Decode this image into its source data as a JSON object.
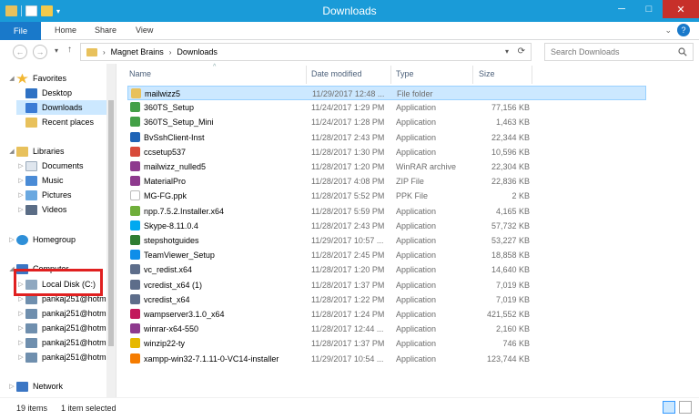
{
  "window": {
    "title": "Downloads",
    "minimize": "─",
    "maximize": "□",
    "close": "✕"
  },
  "ribbon": {
    "tabs": [
      "File",
      "Home",
      "Share",
      "View"
    ],
    "expand": "⌄",
    "help": "?"
  },
  "address": {
    "back": "←",
    "forward": "→",
    "recent": "▾",
    "up": "↑",
    "chevron": "›",
    "crumbs": [
      "Magnet Brains",
      "Downloads"
    ],
    "search_placeholder": "Search Downloads"
  },
  "nav": {
    "favorites": "Favorites",
    "desktop": "Desktop",
    "downloads": "Downloads",
    "recent_places": "Recent places",
    "libraries": "Libraries",
    "documents": "Documents",
    "music": "Music",
    "pictures": "Pictures",
    "videos": "Videos",
    "homegroup": "Homegroup",
    "computer": "Computer",
    "local_disk": "Local Disk (C:)",
    "network_drives": [
      "pankaj251@hotm",
      "pankaj251@hotm",
      "pankaj251@hotm",
      "pankaj251@hotm",
      "pankaj251@hotm"
    ],
    "network": "Network"
  },
  "columns": {
    "name": "Name",
    "date": "Date modified",
    "type": "Type",
    "size": "Size",
    "sort_indicator": "^"
  },
  "files": [
    {
      "name": "mailwizz5",
      "date": "11/29/2017 12:48 ...",
      "type": "File folder",
      "size": "",
      "icon": "folder-icon",
      "color": "#e8c15c"
    },
    {
      "name": "360TS_Setup",
      "date": "11/24/2017 1:29 PM",
      "type": "Application",
      "size": "77,156 KB",
      "icon": "app-360-icon",
      "color": "#43a047"
    },
    {
      "name": "360TS_Setup_Mini",
      "date": "11/24/2017 1:28 PM",
      "type": "Application",
      "size": "1,463 KB",
      "icon": "app-360-icon",
      "color": "#43a047"
    },
    {
      "name": "BvSshClient-Inst",
      "date": "11/28/2017 2:43 PM",
      "type": "Application",
      "size": "22,344 KB",
      "icon": "app-bvssh-icon",
      "color": "#1e63b6"
    },
    {
      "name": "ccsetup537",
      "date": "11/28/2017 1:30 PM",
      "type": "Application",
      "size": "10,596 KB",
      "icon": "app-ccleaner-icon",
      "color": "#d84b3b"
    },
    {
      "name": "mailwizz_nulled5",
      "date": "11/28/2017 1:20 PM",
      "type": "WinRAR archive",
      "size": "22,304 KB",
      "icon": "winrar-icon",
      "color": "#8e3a8e"
    },
    {
      "name": "MaterialPro",
      "date": "11/28/2017 4:08 PM",
      "type": "ZIP File",
      "size": "22,836 KB",
      "icon": "zip-icon",
      "color": "#8e3a8e"
    },
    {
      "name": "MG-FG.ppk",
      "date": "11/28/2017 5:52 PM",
      "type": "PPK File",
      "size": "2 KB",
      "icon": "file-icon",
      "color": "#ffffff"
    },
    {
      "name": "npp.7.5.2.Installer.x64",
      "date": "11/28/2017 5:59 PM",
      "type": "Application",
      "size": "4,165 KB",
      "icon": "app-npp-icon",
      "color": "#6fae3a"
    },
    {
      "name": "Skype-8.11.0.4",
      "date": "11/28/2017 2:43 PM",
      "type": "Application",
      "size": "57,732 KB",
      "icon": "app-skype-icon",
      "color": "#00a9f0"
    },
    {
      "name": "stepshotguides",
      "date": "11/29/2017 10:57 ...",
      "type": "Application",
      "size": "53,227 KB",
      "icon": "app-stepshot-icon",
      "color": "#2e7d32"
    },
    {
      "name": "TeamViewer_Setup",
      "date": "11/28/2017 2:45 PM",
      "type": "Application",
      "size": "18,858 KB",
      "icon": "app-teamviewer-icon",
      "color": "#0e8ee9"
    },
    {
      "name": "vc_redist.x64",
      "date": "11/28/2017 1:20 PM",
      "type": "Application",
      "size": "14,640 KB",
      "icon": "app-installer-icon",
      "color": "#5d6d8a"
    },
    {
      "name": "vcredist_x64 (1)",
      "date": "11/28/2017 1:37 PM",
      "type": "Application",
      "size": "7,019 KB",
      "icon": "app-installer-icon",
      "color": "#5d6d8a"
    },
    {
      "name": "vcredist_x64",
      "date": "11/28/2017 1:22 PM",
      "type": "Application",
      "size": "7,019 KB",
      "icon": "app-installer-icon",
      "color": "#5d6d8a"
    },
    {
      "name": "wampserver3.1.0_x64",
      "date": "11/28/2017 1:24 PM",
      "type": "Application",
      "size": "421,552 KB",
      "icon": "app-wamp-icon",
      "color": "#c2185b"
    },
    {
      "name": "winrar-x64-550",
      "date": "11/28/2017 12:44 ...",
      "type": "Application",
      "size": "2,160 KB",
      "icon": "winrar-icon",
      "color": "#8e3a8e"
    },
    {
      "name": "winzip22-ty",
      "date": "11/28/2017 1:37 PM",
      "type": "Application",
      "size": "746 KB",
      "icon": "app-winzip-icon",
      "color": "#e6b800"
    },
    {
      "name": "xampp-win32-7.1.11-0-VC14-installer",
      "date": "11/29/2017 10:54 ...",
      "type": "Application",
      "size": "123,744 KB",
      "icon": "app-xampp-icon",
      "color": "#f57c00"
    }
  ],
  "status": {
    "items": "19 items",
    "selected": "1 item selected"
  }
}
